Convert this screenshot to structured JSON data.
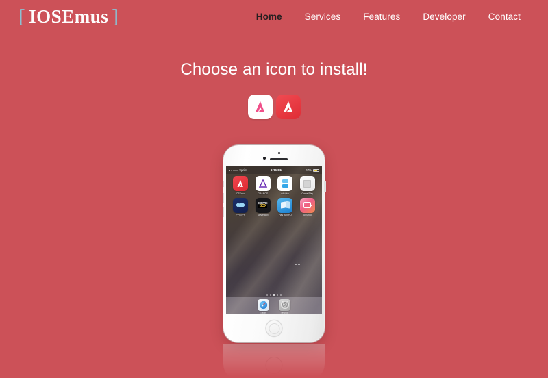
{
  "site": {
    "background_color": "#cc5158",
    "logo": {
      "bracket_left": "[",
      "word": "IOSEmus",
      "bracket_right": "]",
      "bracket_color": "#7fd4e8"
    }
  },
  "nav": {
    "items": [
      {
        "label": "Home",
        "active": true
      },
      {
        "label": "Services",
        "active": false
      },
      {
        "label": "Features",
        "active": false
      },
      {
        "label": "Developer",
        "active": false
      },
      {
        "label": "Contact",
        "active": false
      }
    ]
  },
  "hero": {
    "headline": "Choose an icon to install!"
  },
  "chooser": {
    "options": [
      {
        "name": "iosemus-icon-white",
        "style": "light",
        "mark_color": "#f0508a"
      },
      {
        "name": "iosemus-icon-red",
        "style": "dark",
        "mark_color": "#ffffff"
      }
    ]
  },
  "phone": {
    "status_bar": {
      "carrier": "Sprint",
      "time": "9:36 PM",
      "battery_percent": "67%"
    },
    "apps": [
      {
        "label": "iOSEmus",
        "icon": "iosemus-app-icon"
      },
      {
        "label": "GBA4iOS",
        "icon": "gba4ios-app-icon"
      },
      {
        "label": "nds4ios",
        "icon": "nds4ios-app-icon"
      },
      {
        "label": "Game Play",
        "icon": "gameplay-app-icon"
      },
      {
        "label": "PPSSPP",
        "icon": "ppsspp-app-icon"
      },
      {
        "label": "Movie Box",
        "icon": "moviebox-app-icon",
        "line1": "MOVIE",
        "line2": "BOX"
      },
      {
        "label": "Play Box HD",
        "icon": "playbox-app-icon"
      },
      {
        "label": "AirShou",
        "icon": "airshou-app-icon"
      }
    ],
    "dock": [
      {
        "label": "Safari",
        "icon": "safari-app-icon"
      },
      {
        "label": "Settings",
        "icon": "settings-app-icon"
      }
    ],
    "page_dots": {
      "count": 5,
      "active_index": 2
    }
  }
}
